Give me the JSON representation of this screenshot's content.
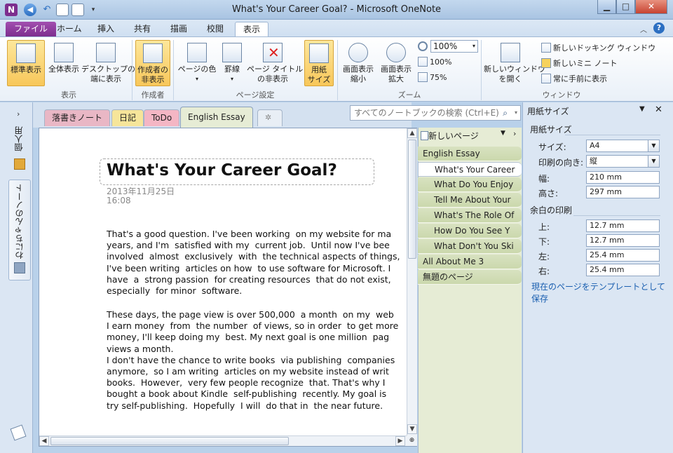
{
  "window": {
    "title": "What's Your Career Goal? - Microsoft OneNote"
  },
  "ribbon_tabs": [
    "ファイル",
    "ホーム",
    "挿入",
    "共有",
    "描画",
    "校閲",
    "表示"
  ],
  "ribbon": {
    "view_group": {
      "buttons": [
        "標準表示",
        "全体表示",
        "デスクトップの\n端に表示"
      ],
      "label": "表示"
    },
    "author_group": {
      "buttons": [
        "作成者の\n非表示"
      ],
      "label": "作成者"
    },
    "page_setup_group": {
      "buttons": [
        "ページの色",
        "罫線",
        "ページ タイトル\nの非表示",
        "用紙\nサイズ"
      ],
      "label": "ページ設定"
    },
    "zoom_group": {
      "buttons": [
        "画面表示\n縮小",
        "画面表示\n拡大"
      ],
      "zoom_value": "100%",
      "presets": [
        "100%",
        "75%"
      ],
      "label": "ズーム"
    },
    "window_group": {
      "big_button": "新しいウィンドウ\nを開く",
      "items": [
        "新しいドッキング ウィンドウ",
        "新しいミニ ノート",
        "常に手前に表示"
      ],
      "label": "ウィンドウ"
    }
  },
  "notebook": {
    "name": "わにちゃんのノート",
    "personal": "個人用"
  },
  "section_tabs": [
    "落書きノート",
    "日記",
    "ToDo",
    "English Essay"
  ],
  "search": {
    "placeholder": "すべてのノートブックの検索 (Ctrl+E)"
  },
  "page": {
    "title": "What's Your Career Goal?",
    "date": "2013年11月25日",
    "time": "16:08",
    "para1": "That's a good question. I've been working  on my website for ma\nyears, and I'm  satisfied with my  current job.  Until now I've bee\ninvolved  almost  exclusively  with  the technical aspects of things,\nI've been writing  articles on how  to use software for Microsoft. I\nhave  a  strong passion  for creating resources  that do not exist,\nespecially  for minor  software.",
    "para2": "These days, the page view is over 500,000  a month  on my  web\nI earn money  from  the number  of views, so in order  to get more\nmoney, I'll keep doing my  best. My next goal is one million  pag\nviews a month.\nI don't have the chance to write books  via publishing  companies\nanymore,  so I am writing  articles on my website instead of writ\nbooks.  However,  very few people recognize  that. That's why I\nbought a book about Kindle  self-publishing  recently. My goal is\ntry self-publishing.  Hopefully  I will  do that in  the near future."
  },
  "pages_pane": {
    "new_page": "新しいページ",
    "items": [
      {
        "label": "English Essay",
        "level": "top"
      },
      {
        "label": "What's Your Career",
        "level": "sub",
        "selected": true
      },
      {
        "label": "What Do You Enjoy",
        "level": "sub"
      },
      {
        "label": "Tell Me About Your",
        "level": "sub"
      },
      {
        "label": "What's The Role Of",
        "level": "sub"
      },
      {
        "label": "How Do You See Y",
        "level": "sub"
      },
      {
        "label": "What Don't You Ski",
        "level": "sub"
      },
      {
        "label": "All About Me 3",
        "level": "top"
      },
      {
        "label": "無題のページ",
        "level": "top"
      }
    ]
  },
  "task_pane": {
    "title": "用紙サイズ",
    "paper_section": "用紙サイズ",
    "size_label": "サイズ:",
    "size_value": "A4",
    "orientation_label": "印刷の向き:",
    "orientation_value": "縦",
    "width_label": "幅:",
    "width_value": "210 mm",
    "height_label": "高さ:",
    "height_value": "297 mm",
    "margin_section": "余白の印刷",
    "top_label": "上:",
    "top_value": "12.7 mm",
    "bottom_label": "下:",
    "bottom_value": "12.7 mm",
    "left_label": "左:",
    "left_value": "25.4 mm",
    "right_label": "右:",
    "right_value": "25.4 mm",
    "template_link": "現在のページをテンプレートとして保存"
  },
  "colors": {
    "file_tab": "#7d2e8e",
    "selected_button": "#f8c75a",
    "pages_pane": "#d8e2c1",
    "link": "#1a5fb0"
  }
}
